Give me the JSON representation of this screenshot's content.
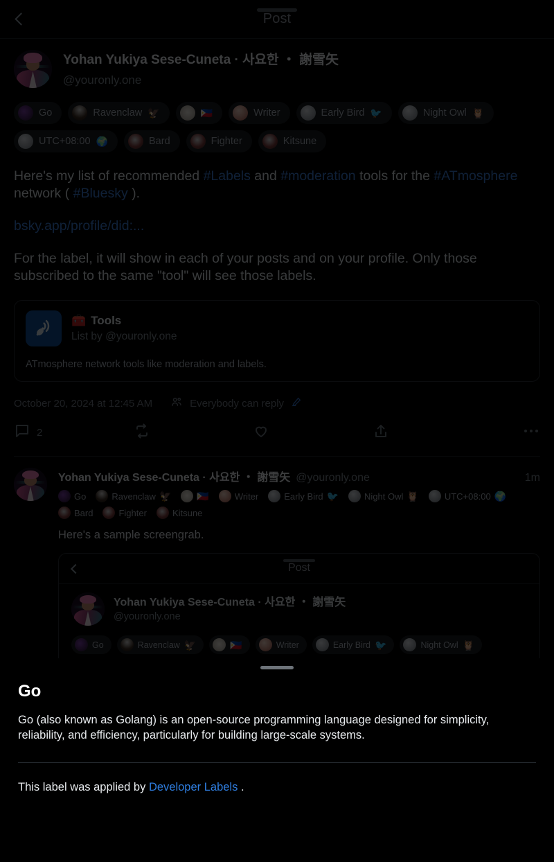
{
  "header": {
    "title": "Post",
    "back_icon": "chevron-left-icon"
  },
  "post": {
    "author": {
      "display_name": "Yohan Yukiya Sese-Cuneta · 사요한 ・ 謝雪矢",
      "handle": "@youronly.one"
    },
    "badges": [
      {
        "label": "Go",
        "emoji": "",
        "av": "cav-go"
      },
      {
        "label": "Ravenclaw",
        "emoji": "🦅",
        "av": "cav-raven"
      },
      {
        "label": "",
        "emoji": "🇵🇭",
        "av": "cav-ph"
      },
      {
        "label": "Writer",
        "emoji": "",
        "av": "cav-writer"
      },
      {
        "label": "Early Bird",
        "emoji": "🐦",
        "av": "cav-moon"
      },
      {
        "label": "Night Owl",
        "emoji": "🦉",
        "av": "cav-moon"
      },
      {
        "label": "UTC+08:00",
        "emoji": "🌍",
        "av": "cav-moon"
      },
      {
        "label": "Bard",
        "emoji": "",
        "av": "cav-bard"
      },
      {
        "label": "Fighter",
        "emoji": "",
        "av": "cav-bard"
      },
      {
        "label": "Kitsune",
        "emoji": "",
        "av": "cav-bard"
      }
    ],
    "text": {
      "p1_a": "Here's my list of recommended ",
      "p1_tag1": "#Labels",
      "p1_b": " and ",
      "p1_tag2": "#moderation",
      "p1_c": " tools for the ",
      "p1_tag3": "#ATmosphere",
      "p1_d": " network ( ",
      "p1_tag4": "#Bluesky",
      "p1_e": " ).",
      "link": "bsky.app/profile/did:...",
      "p2": "For the label, it will show in each of your posts and on your profile. Only those subscribed to the same \"tool\" will see those labels."
    },
    "embed": {
      "icon": "satellite-dish-icon",
      "emoji": "🧰",
      "title": "Tools",
      "subtitle": "List by @youronly.one",
      "description": "ATmosphere network tools like moderation and labels."
    },
    "meta": {
      "timestamp": "October 20, 2024 at 12:45 AM",
      "audience_icon": "people-icon",
      "audience": "Everybody can reply",
      "edit_icon": "pencil-icon"
    },
    "actions": {
      "reply": {
        "icon": "comment-icon",
        "count": "2"
      },
      "repost": {
        "icon": "repost-icon",
        "count": ""
      },
      "like": {
        "icon": "heart-icon",
        "count": ""
      },
      "share": {
        "icon": "share-icon",
        "count": ""
      },
      "more": {
        "icon": "ellipsis-icon"
      }
    }
  },
  "reply": {
    "display_name": "Yohan Yukiya Sese-Cuneta · 사요한 ・ 謝雪矢",
    "handle": "@youronly.one",
    "time": "1m",
    "badges": [
      {
        "label": "Go",
        "emoji": "",
        "av": "cav-go"
      },
      {
        "label": "Ravenclaw",
        "emoji": "🦅",
        "av": "cav-raven"
      },
      {
        "label": "",
        "emoji": "🇵🇭",
        "av": "cav-ph"
      },
      {
        "label": "Writer",
        "emoji": "",
        "av": "cav-writer"
      },
      {
        "label": "Early Bird",
        "emoji": "🐦",
        "av": "cav-moon"
      },
      {
        "label": "Night Owl",
        "emoji": "🦉",
        "av": "cav-moon"
      },
      {
        "label": "UTC+08:00",
        "emoji": "🌍",
        "av": "cav-moon"
      },
      {
        "label": "Bard",
        "emoji": "",
        "av": "cav-bard"
      },
      {
        "label": "Fighter",
        "emoji": "",
        "av": "cav-bard"
      },
      {
        "label": "Kitsune",
        "emoji": "",
        "av": "cav-bard"
      }
    ],
    "text": "Here's a sample screengrab.",
    "screenshot": {
      "header_title": "Post",
      "display_name": "Yohan Yukiya Sese-Cuneta · 사요한 ・ 謝雪矢",
      "handle": "@youronly.one",
      "badges": [
        {
          "label": "Go",
          "emoji": "",
          "av": "cav-go"
        },
        {
          "label": "Ravenclaw",
          "emoji": "🦅",
          "av": "cav-raven"
        },
        {
          "label": "",
          "emoji": "🇵🇭",
          "av": "cav-ph"
        },
        {
          "label": "Writer",
          "emoji": "",
          "av": "cav-writer"
        },
        {
          "label": "Early Bird",
          "emoji": "🐦",
          "av": "cav-moon"
        },
        {
          "label": "Night Owl",
          "emoji": "🦉",
          "av": "cav-moon"
        }
      ]
    }
  },
  "sheet": {
    "title": "Go",
    "description": "Go (also known as Golang) is an open-source programming language designed for simplicity, reliability, and efficiency, particularly for building large-scale systems.",
    "attribution_prefix": "This label was applied by ",
    "attribution_link": "Developer Labels",
    "attribution_suffix": " ."
  },
  "colors": {
    "background": "#000000",
    "link": "#3a7bd5",
    "sheet_link": "#2f7ee0",
    "text_primary": "#e6ebef",
    "text_muted": "#7d8690",
    "embed_icon_bg": "#0f4c96",
    "divider": "#1c2126"
  }
}
